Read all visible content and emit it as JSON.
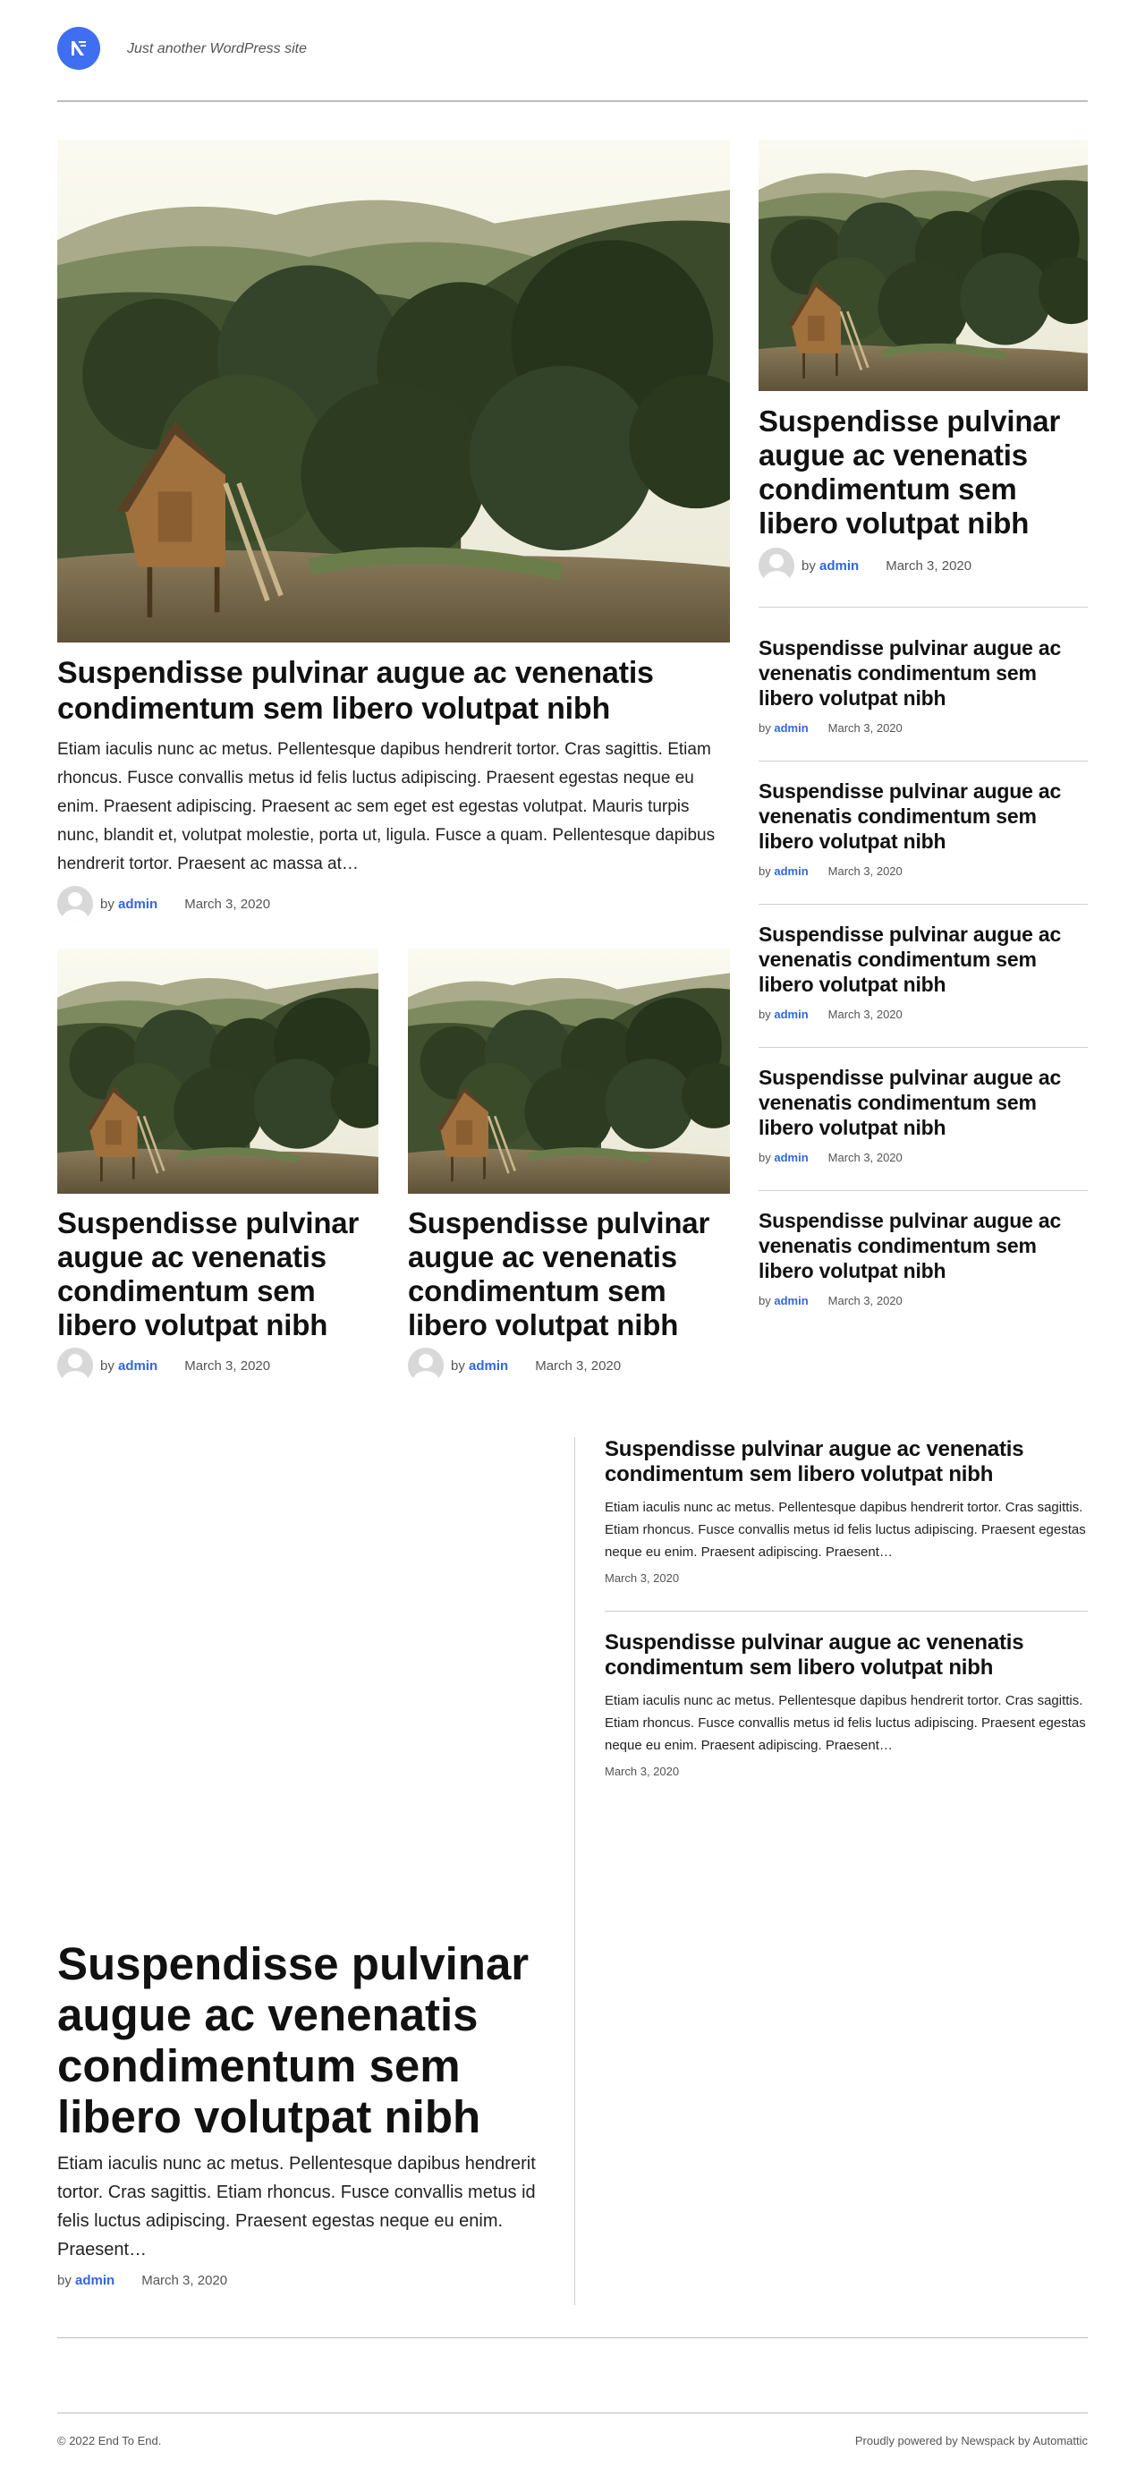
{
  "site": {
    "tagline": "Just another WordPress site"
  },
  "featured": {
    "title": "Suspendisse pulvinar augue ac venenatis condimentum sem libero volutpat nibh",
    "excerpt": "Etiam iaculis nunc ac metus. Pellentesque dapibus hendrerit tortor. Cras sagittis. Etiam rhoncus. Fusce convallis metus id felis luctus adipiscing. Praesent egestas neque eu enim. Praesent adipiscing. Praesent ac sem eget est egestas volutpat. Mauris turpis nunc, blandit et, volutpat molestie, porta ut, ligula. Fusce a quam. Pellentesque dapibus hendrerit tortor. Praesent ac massa at…",
    "by": "by",
    "author": "admin",
    "date": "March 3, 2020"
  },
  "grid_posts": [
    {
      "title": "Suspendisse pulvinar augue ac venenatis condimentum sem libero volutpat nibh",
      "by": "by",
      "author": "admin",
      "date": "March 3, 2020"
    },
    {
      "title": "Suspendisse pulvinar augue ac venenatis condimentum sem libero volutpat nibh",
      "by": "by",
      "author": "admin",
      "date": "March 3, 2020"
    }
  ],
  "sidebar_top": {
    "title": "Suspendisse pulvinar augue ac venenatis condimentum sem libero volutpat nibh",
    "by": "by",
    "author": "admin",
    "date": "March 3, 2020"
  },
  "sidebar_list": [
    {
      "title": "Suspendisse pulvinar augue ac venenatis condimentum sem libero volutpat nibh",
      "by": "by",
      "author": "admin",
      "date": "March 3, 2020"
    },
    {
      "title": "Suspendisse pulvinar augue ac venenatis condimentum sem libero volutpat nibh",
      "by": "by",
      "author": "admin",
      "date": "March 3, 2020"
    },
    {
      "title": "Suspendisse pulvinar augue ac venenatis condimentum sem libero volutpat nibh",
      "by": "by",
      "author": "admin",
      "date": "March 3, 2020"
    },
    {
      "title": "Suspendisse pulvinar augue ac venenatis condimentum sem libero volutpat nibh",
      "by": "by",
      "author": "admin",
      "date": "March 3, 2020"
    },
    {
      "title": "Suspendisse pulvinar augue ac venenatis condimentum sem libero volutpat nibh",
      "by": "by",
      "author": "admin",
      "date": "March 3, 2020"
    }
  ],
  "right_posts": [
    {
      "title": "Suspendisse pulvinar augue ac venenatis condimentum sem libero volutpat nibh",
      "excerpt": "Etiam iaculis nunc ac metus. Pellentesque dapibus hendrerit tortor. Cras sagittis. Etiam rhoncus. Fusce convallis metus id felis luctus adipiscing. Praesent egestas neque eu enim. Praesent adipiscing. Praesent…",
      "date": "March 3, 2020"
    },
    {
      "title": "Suspendisse pulvinar augue ac venenatis condimentum sem libero volutpat nibh",
      "excerpt": "Etiam iaculis nunc ac metus. Pellentesque dapibus hendrerit tortor. Cras sagittis. Etiam rhoncus. Fusce convallis metus id felis luctus adipiscing. Praesent egestas neque eu enim. Praesent adipiscing. Praesent…",
      "date": "March 3, 2020"
    }
  ],
  "big_post": {
    "title": "Suspendisse pulvinar augue ac venenatis condimentum sem libero volutpat nibh",
    "excerpt": "Etiam iaculis nunc ac metus. Pellentesque dapibus hendrerit tortor. Cras sagittis. Etiam rhoncus. Fusce convallis metus id felis luctus adipiscing. Praesent egestas neque eu enim. Praesent…",
    "by": "by",
    "author": "admin",
    "date": "March 3, 2020"
  },
  "footer": {
    "copyright": "© 2022 End To End.",
    "powered": "Proudly powered by Newspack by Automattic"
  },
  "colors": {
    "accent": "#3f6ef0",
    "link": "#3366dd",
    "divider": "#cfcfcf"
  }
}
